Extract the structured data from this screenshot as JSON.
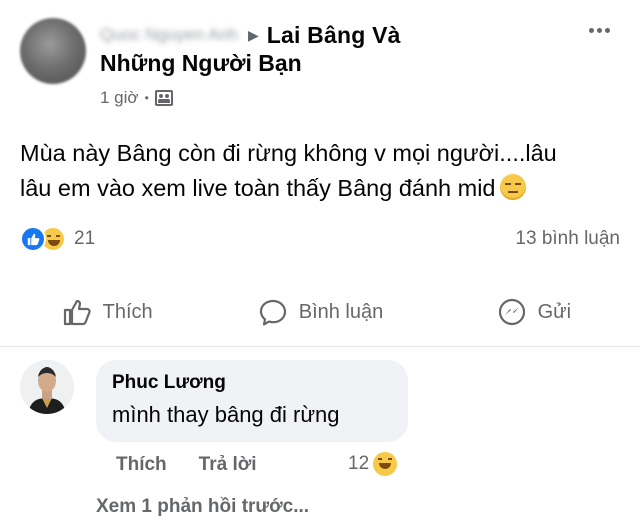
{
  "post": {
    "author_name": "Quoc Nguyen Anh",
    "arrow": "▶",
    "group_name_line1": "Lai Bâng Và",
    "group_name_line2": "Những Người Bạn",
    "time": "1 giờ",
    "dot": "•",
    "privacy_icon": "group-icon",
    "text_line1": "Mùa này Bâng còn đi rừng không v mọi người....lâu",
    "text_line2": "lâu em vào xem live toàn thấy Bâng đánh mid",
    "emoji": "expressionless-emoji"
  },
  "stats": {
    "reaction_icons": [
      "like-icon",
      "haha-icon"
    ],
    "reaction_count": "21",
    "comment_count": "13 bình luận"
  },
  "actions": {
    "like": "Thích",
    "comment": "Bình luận",
    "send": "Gửi"
  },
  "comment": {
    "name": "Phuc Lương",
    "text": "mình thay bâng đi rừng",
    "like": "Thích",
    "reply": "Trả lời",
    "reaction_count": "12",
    "reaction_icon": "haha-icon"
  },
  "view_more": "Xem 1 phản hồi trước..."
}
